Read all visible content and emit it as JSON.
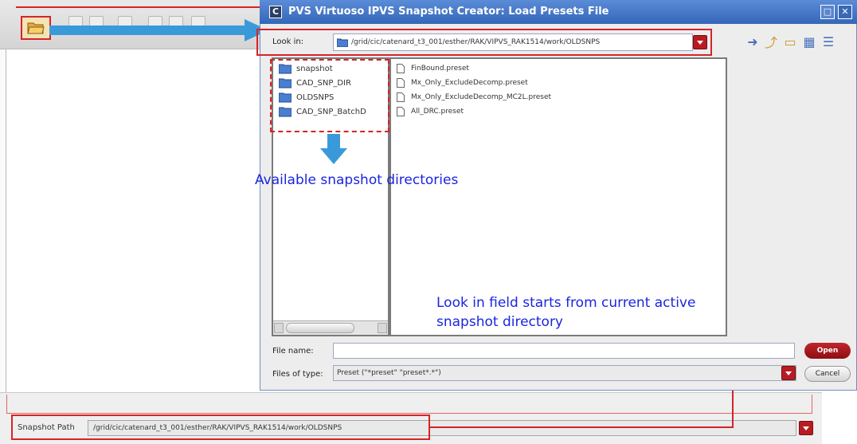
{
  "main_window": {
    "snapshot_path_label": "Snapshot Path",
    "snapshot_path_value": "/grid/cic/catenard_t3_001/esther/RAK/VIPVS_RAK1514/work/OLDSNPS"
  },
  "dialog": {
    "title": "PVS Virtuoso IPVS Snapshot Creator: Load Presets File",
    "title_icon_letter": "C",
    "look_in_label": "Look in:",
    "look_in_value": "/grid/cic/catenard_t3_001/esther/RAK/VIPVS_RAK1514/work/OLDSNPS",
    "side_items": [
      "snapshot",
      "CAD_SNP_DIR",
      "OLDSNPS",
      "CAD_SNP_BatchD"
    ],
    "files": [
      "FinBound.preset",
      "Mx_Only_ExcludeDecomp.preset",
      "Mx_Only_ExcludeDecomp_MC2L.preset",
      "All_DRC.preset"
    ],
    "file_name_label": "File name:",
    "file_name_value": "",
    "files_of_type_label": "Files of type:",
    "files_of_type_value": "Preset (\"*preset\" \"preset*.*\")",
    "open_button": "Open",
    "cancel_button": "Cancel"
  },
  "annotations": {
    "available_dirs": "Available snapshot directories",
    "look_in_note_line1": "Look in field starts from current active",
    "look_in_note_line2": "snapshot directory"
  },
  "colors": {
    "annotation_red": "#d6232a",
    "annotation_blue_text": "#1a25e0",
    "arrow_blue": "#3a9ad9",
    "title_blue": "#3366b8"
  }
}
